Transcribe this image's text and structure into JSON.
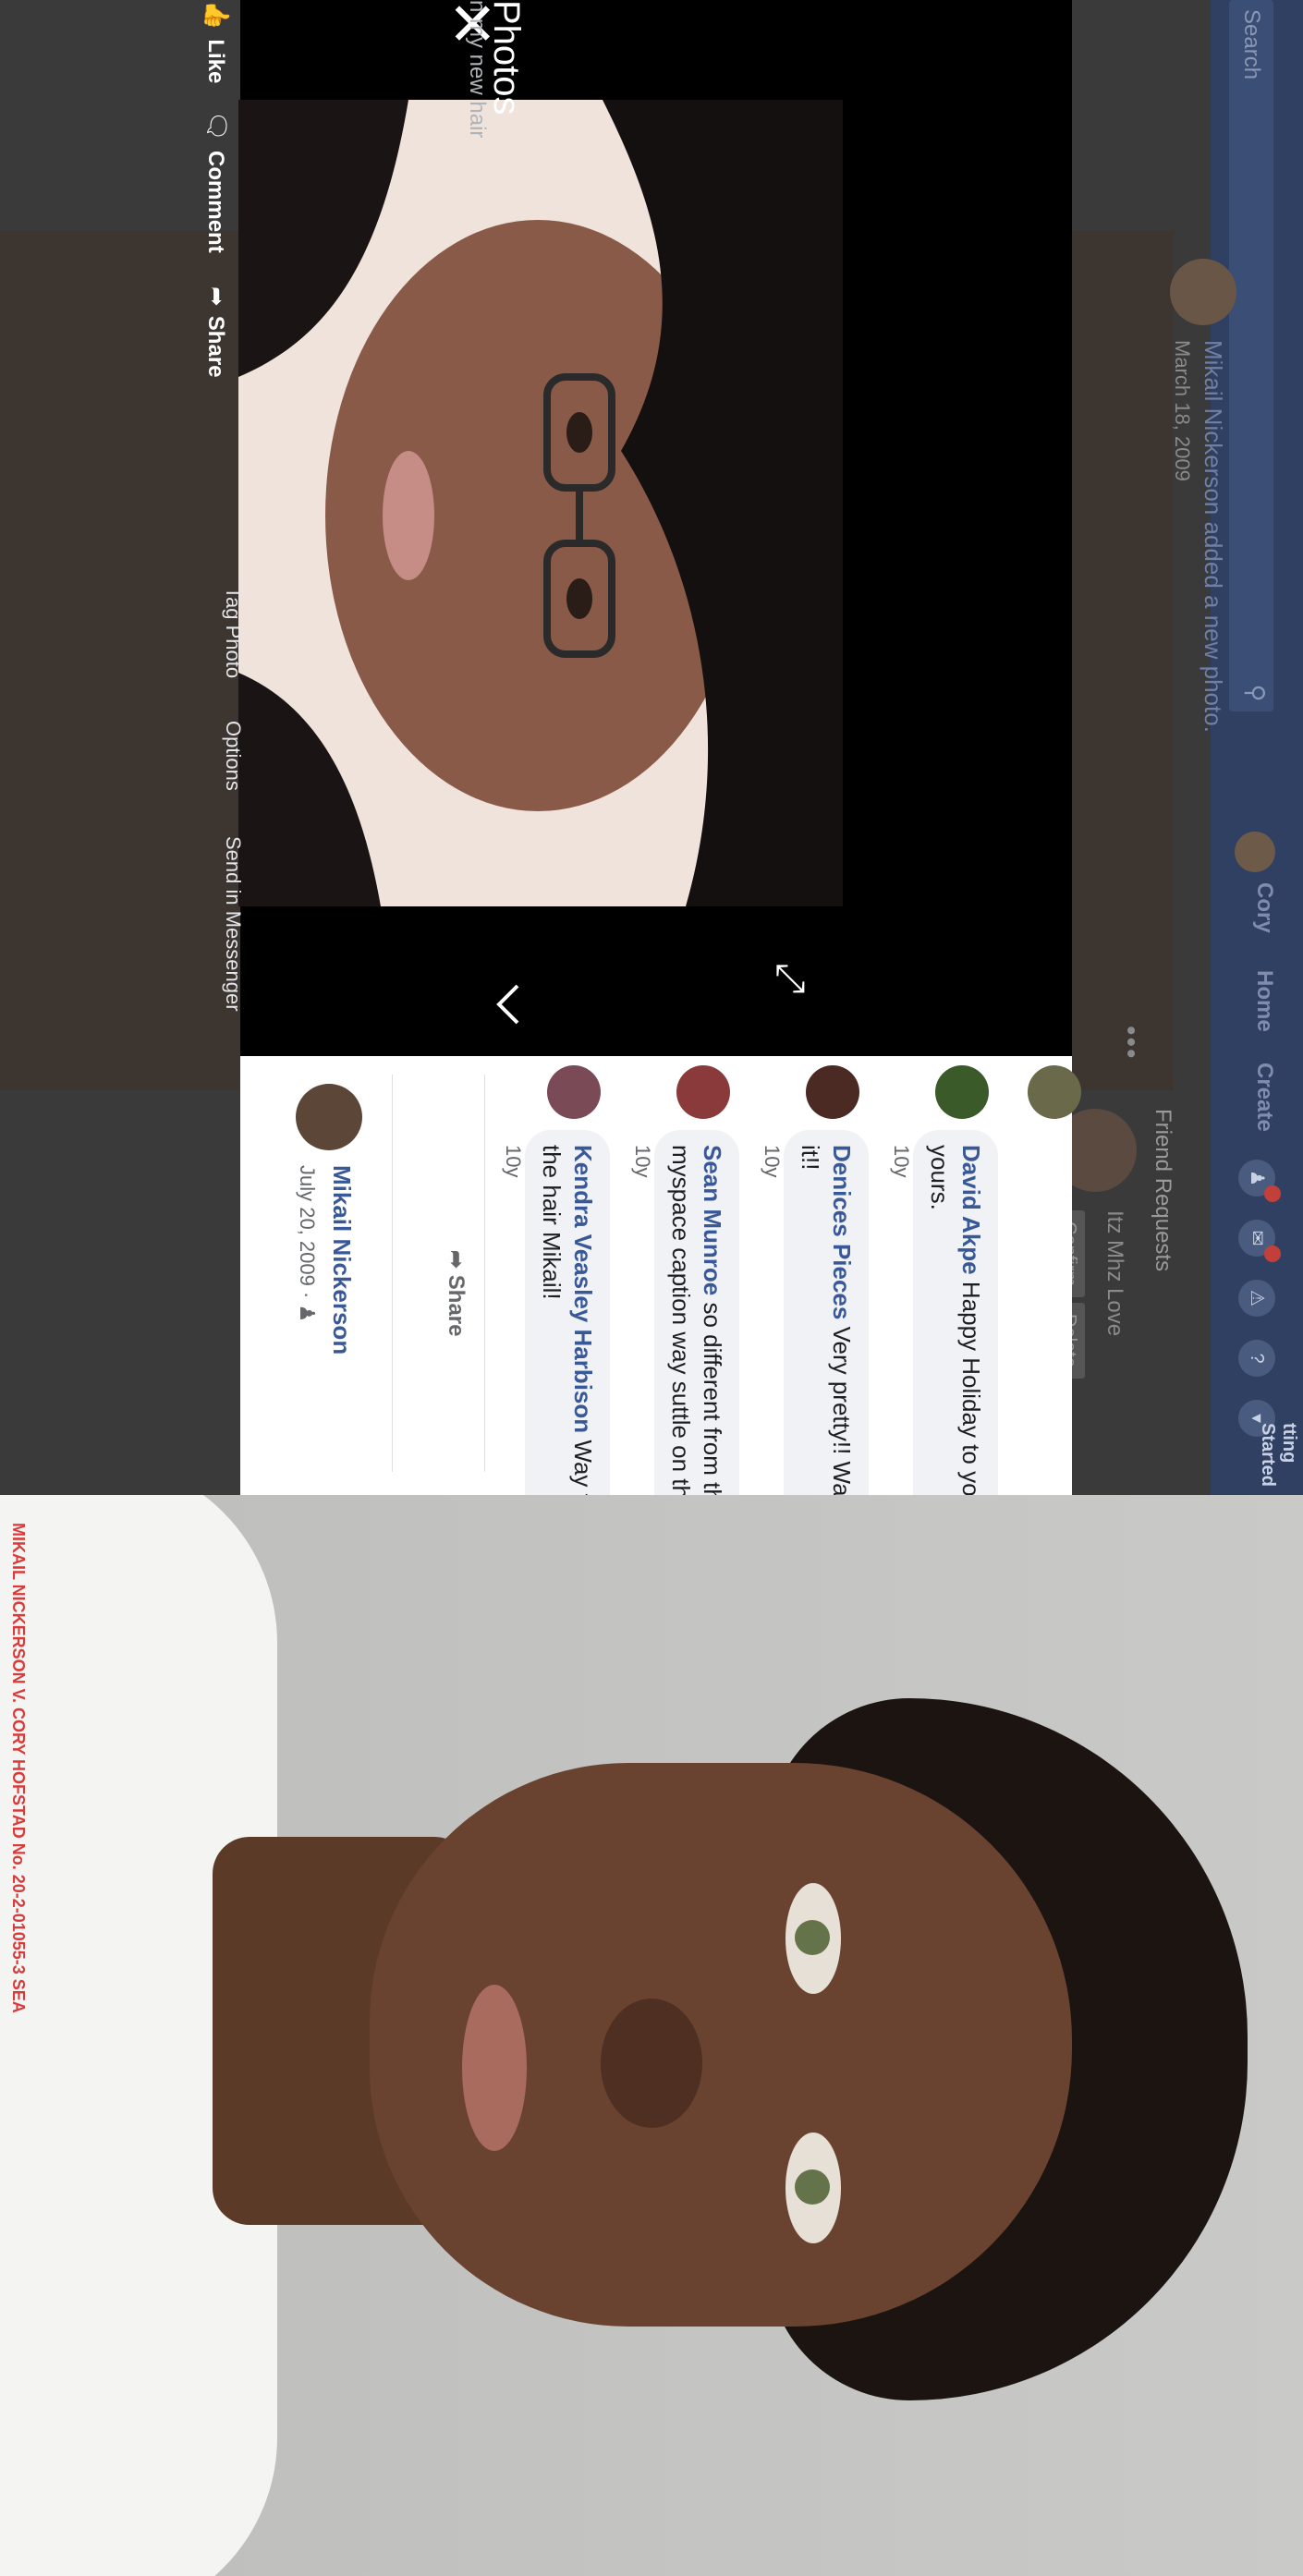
{
  "background_page": {
    "search_placeholder": "Search",
    "nav": {
      "user": "Cory",
      "home": "Home",
      "create": "Create"
    },
    "post": {
      "author": "Mikail Nickerson",
      "action": "added a new photo.",
      "date": "March 18, 2009"
    },
    "friend_requests": {
      "title": "Friend Requests",
      "name": "Itz Mhz Love",
      "confirm": "Confirm",
      "delete": "Delete"
    },
    "header_partial": "tting Started"
  },
  "viewer": {
    "title": "Photos",
    "caption": "n my new hair",
    "actions": {
      "like": "Like",
      "comment": "Comment",
      "share": "Share"
    },
    "tools": {
      "tag": "Tag Photo",
      "options": "Options",
      "send": "Send in Messenger"
    }
  },
  "comments_panel": {
    "poster": {
      "name": "Mikail Nickerson",
      "date": "July 20, 2009 · "
    },
    "share_label": "Share",
    "comments": [
      {
        "author": "Kendra Veasley Harbison",
        "text": "Way to go on the hair Mikail!",
        "time": "10y"
      },
      {
        "author": "Sean Munroe",
        "text": "so different from the myspace caption way suttle on this one",
        "time": "10y"
      },
      {
        "author": "Denices Pieces",
        "text": "Very pretty!! Way to go on it!!",
        "time": "10y"
      },
      {
        "author": "David Akpe",
        "text": "Happy Holiday to you and yours.",
        "time": "10y"
      }
    ]
  },
  "exhibit_caption": "MIKAIL NICKERSON V. CORY HOFSTAD No. 20-2-01055-3 SEA",
  "colors": {
    "fb_blue": "#385898",
    "viewer_black": "#000000",
    "caption_red": "#d93a3a"
  }
}
